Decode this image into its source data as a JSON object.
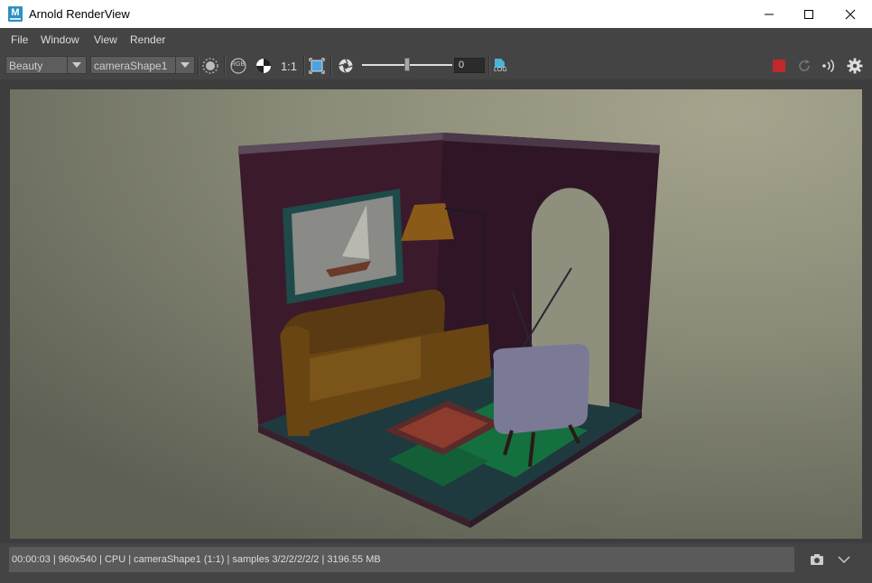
{
  "window": {
    "app_icon_letter": "M",
    "title": "Arnold RenderView",
    "minimize_glyph": "minimize-icon",
    "maximize_glyph": "maximize-icon",
    "close_glyph": "close-icon"
  },
  "menu": {
    "items": [
      {
        "label": "File"
      },
      {
        "label": "Window"
      },
      {
        "label": "View"
      },
      {
        "label": "Render"
      }
    ]
  },
  "toolbar": {
    "aov_value": "Beauty",
    "camera_value": "cameraShape1",
    "ratio_label": "1:1",
    "exposure_value": "0",
    "exposure_level": 0.5,
    "rgb_label": "RGB",
    "log_label": "LOG",
    "stop_color": "#c0282d"
  },
  "status": {
    "text": "00:00:03 | 960x540 | CPU | cameraShape1 (1:1) | samples 3/2/2/2/2/2 | 3196.55 MB"
  }
}
